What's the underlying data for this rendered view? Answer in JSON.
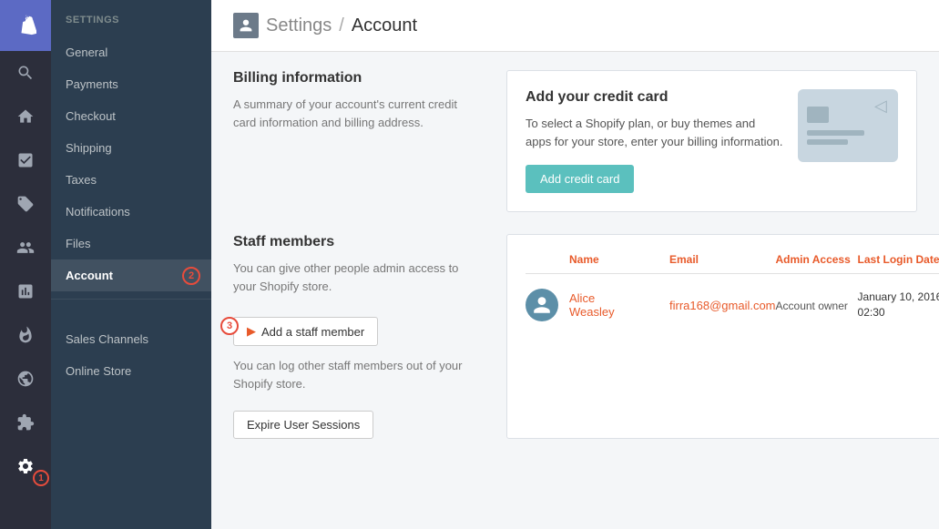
{
  "app": {
    "logo": "🛍",
    "settings_label": "SETTINGS"
  },
  "breadcrumb": {
    "icon": "👤",
    "path": "Settings",
    "separator": "/",
    "current": "Account"
  },
  "sidebar": {
    "items": [
      {
        "id": "general",
        "label": "General"
      },
      {
        "id": "payments",
        "label": "Payments"
      },
      {
        "id": "checkout",
        "label": "Checkout"
      },
      {
        "id": "shipping",
        "label": "Shipping"
      },
      {
        "id": "taxes",
        "label": "Taxes"
      },
      {
        "id": "notifications",
        "label": "Notifications"
      },
      {
        "id": "files",
        "label": "Files"
      },
      {
        "id": "account",
        "label": "Account",
        "active": true
      }
    ],
    "sub_items": [
      {
        "id": "sales-channels",
        "label": "Sales Channels"
      },
      {
        "id": "online-store",
        "label": "Online Store"
      }
    ]
  },
  "billing": {
    "title": "Billing information",
    "description": "A summary of your account's current credit card information and billing address.",
    "card_title": "Add your credit card",
    "card_description": "To select a Shopify plan, or buy themes and apps for your store, enter your billing information.",
    "button_label": "Add credit card"
  },
  "staff": {
    "title": "Staff members",
    "description": "You can give other people admin access to your Shopify store.",
    "add_button": "Add a staff member",
    "logout_description": "You can log other staff members out of your Shopify store.",
    "expire_button": "Expire User Sessions",
    "table": {
      "headers": {
        "name": "Name",
        "email": "Email",
        "access": "Admin Access",
        "login": "Last Login Date"
      },
      "rows": [
        {
          "avatar_icon": "👤",
          "name": "Alice\nWeasley",
          "email": "firra168@gmail.com",
          "access": "Account owner",
          "login": "January 10, 2016 02:30"
        }
      ]
    }
  },
  "icon_sidebar": {
    "icons": [
      {
        "id": "search",
        "symbol": "🔍"
      },
      {
        "id": "home",
        "symbol": "🏠"
      },
      {
        "id": "orders",
        "symbol": "☑"
      },
      {
        "id": "tags",
        "symbol": "🏷"
      },
      {
        "id": "customers",
        "symbol": "👥"
      },
      {
        "id": "analytics",
        "symbol": "📊"
      },
      {
        "id": "marketing",
        "symbol": "⚡"
      },
      {
        "id": "globe",
        "symbol": "🌐"
      },
      {
        "id": "apps",
        "symbol": "⚙"
      },
      {
        "id": "settings",
        "symbol": "⚙",
        "active": true
      }
    ]
  },
  "badges": {
    "badge1_number": "1",
    "badge2_number": "2",
    "badge3_number": "3"
  }
}
